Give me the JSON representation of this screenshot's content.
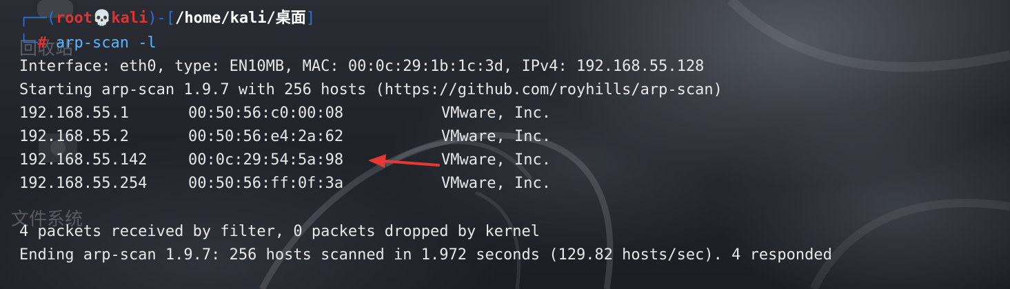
{
  "desktop": {
    "labels": [
      "回收站",
      "文件系统"
    ],
    "icon_names": [
      "trash-icon",
      "drive-icon"
    ]
  },
  "prompt": {
    "line1_open": "┌──(",
    "user": "root",
    "skull": "💀",
    "host": "kali",
    "mid": ")-[",
    "path": "/home/kali/桌面",
    "close": "]",
    "line2_corner": "└─",
    "hash": "#",
    "command": " arp-scan -l"
  },
  "output": {
    "interface_line": "Interface: eth0, type: EN10MB, MAC: 00:0c:29:1b:1c:3d, IPv4: 192.168.55.128",
    "starting_line": "Starting arp-scan 1.9.7 with 256 hosts (https://github.com/royhills/arp-scan)",
    "hosts": [
      {
        "ip": "192.168.55.1",
        "mac": "00:50:56:c0:00:08",
        "vendor": "VMware, Inc."
      },
      {
        "ip": "192.168.55.2",
        "mac": "00:50:56:e4:2a:62",
        "vendor": "VMware, Inc."
      },
      {
        "ip": "192.168.55.142",
        "mac": "00:0c:29:54:5a:98",
        "vendor": "VMware, Inc."
      },
      {
        "ip": "192.168.55.254",
        "mac": "00:50:56:ff:0f:3a",
        "vendor": "VMware, Inc."
      }
    ],
    "packets_line": "4 packets received by filter, 0 packets dropped by kernel",
    "ending_line": "Ending arp-scan 1.9.7: 256 hosts scanned in 1.972 seconds (129.82 hosts/sec). 4 responded"
  },
  "colors": {
    "prompt_frame": "#2f6fd8",
    "root_user": "#e03232",
    "command": "#57b6ff",
    "annotation_arrow": "#e53935"
  }
}
